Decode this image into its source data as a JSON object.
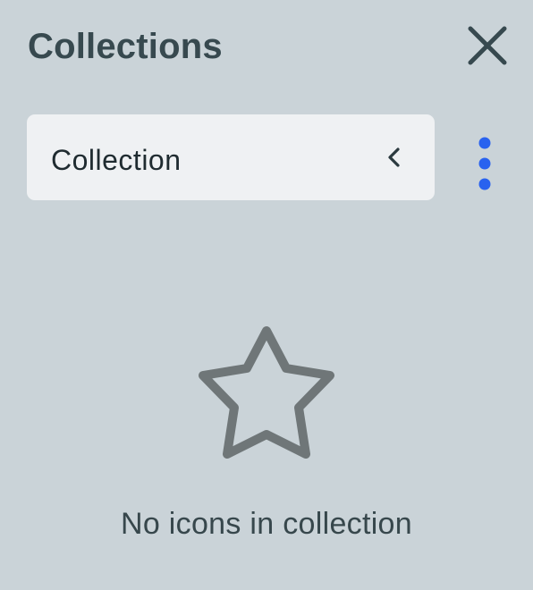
{
  "header": {
    "title": "Collections",
    "close_icon": "close-icon"
  },
  "selector": {
    "label": "Collection",
    "chevron_icon": "chevron-left-icon",
    "more_icon": "more-vertical-icon"
  },
  "empty_state": {
    "icon": "star-icon",
    "message": "No icons in collection"
  },
  "colors": {
    "background": "#cad3d8",
    "title": "#37494f",
    "selector_bg": "#eff1f3",
    "accent": "#2962ef",
    "icon_gray": "#6f7678",
    "text": "#37474c"
  }
}
